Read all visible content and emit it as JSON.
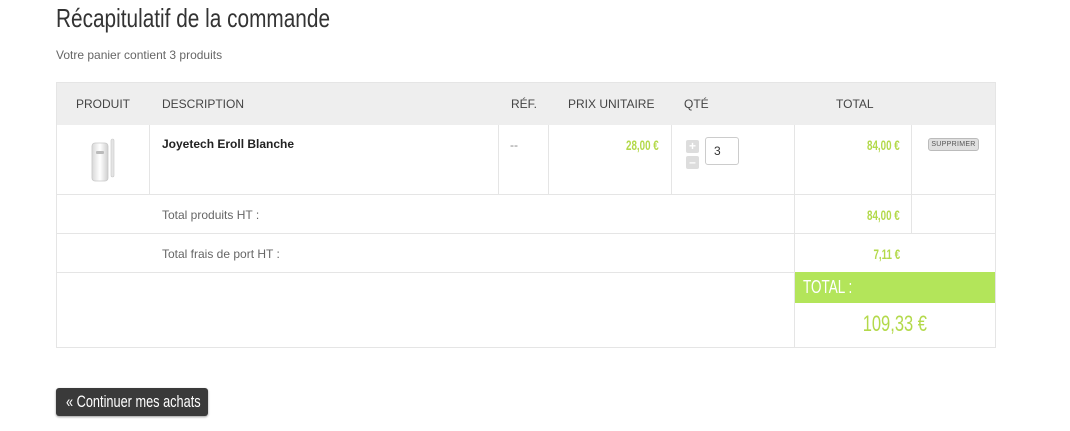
{
  "page": {
    "title": "Récapitulatif de la commande",
    "cart_summary": "Votre panier contient 3 produits"
  },
  "table": {
    "headers": {
      "product": "PRODUIT",
      "description": "DESCRIPTION",
      "ref": "RÉF.",
      "unit_price": "PRIX UNITAIRE",
      "qty": "QTÉ",
      "total": "TOTAL"
    },
    "items": [
      {
        "name": "Joyetech Eroll Blanche",
        "ref": "--",
        "unit_price": "28,00 €",
        "quantity": "3",
        "total": "84,00 €",
        "delete_label": "SUPPRIMER"
      }
    ],
    "totals": {
      "products_label": "Total produits HT :",
      "products_value": "84,00 €",
      "shipping_label": "Total frais de port HT :",
      "shipping_value": "7,11 €",
      "total_label": "TOTAL :",
      "total_value": "109,33 €"
    }
  },
  "actions": {
    "continue_label": "« Continuer mes achats"
  },
  "colors": {
    "accent_green": "#b3e55a",
    "price_green": "#b3d94a",
    "header_bg": "#eeeeee",
    "button_dark": "#3a3a3a"
  },
  "icons": {
    "qty_increase": "plus-icon",
    "qty_decrease": "minus-icon"
  }
}
